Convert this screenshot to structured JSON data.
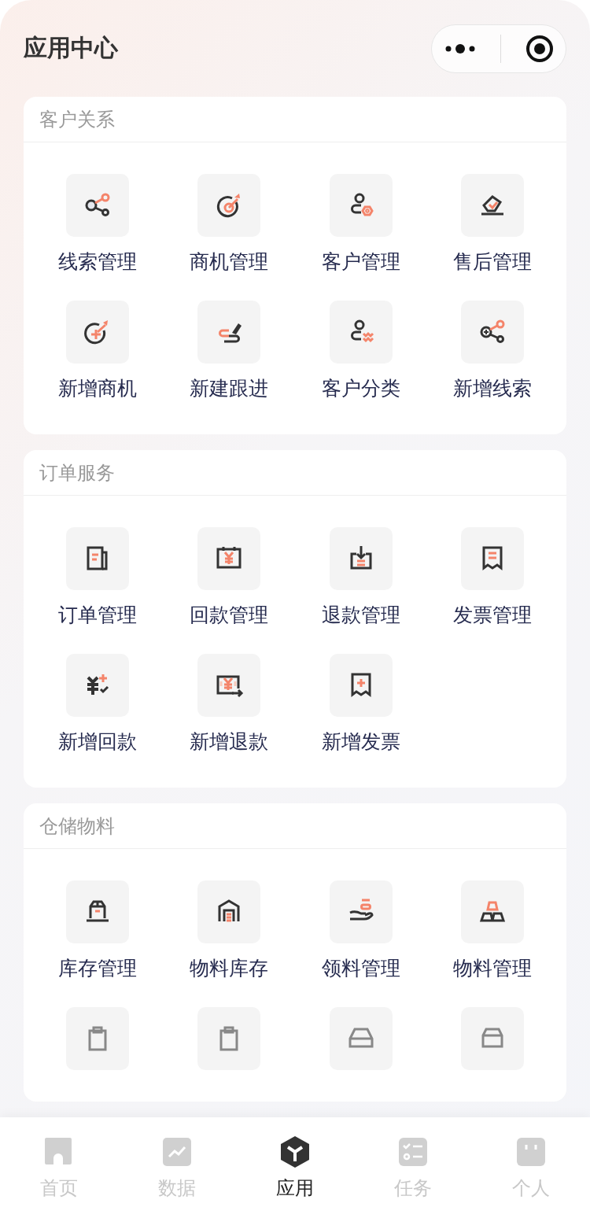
{
  "header": {
    "title": "应用中心"
  },
  "sections": [
    {
      "title": "客户关系",
      "items": [
        {
          "kind": "app",
          "label": "线索管理"
        },
        {
          "kind": "app",
          "label": "商机管理"
        },
        {
          "kind": "app",
          "label": "客户管理"
        },
        {
          "kind": "app",
          "label": "售后管理"
        },
        {
          "kind": "app",
          "label": "新增商机"
        },
        {
          "kind": "app",
          "label": "新建跟进"
        },
        {
          "kind": "app",
          "label": "客户分类"
        },
        {
          "kind": "app",
          "label": "新增线索"
        }
      ]
    },
    {
      "title": "订单服务",
      "items": [
        {
          "kind": "app",
          "label": "订单管理"
        },
        {
          "kind": "app",
          "label": "回款管理"
        },
        {
          "kind": "app",
          "label": "退款管理"
        },
        {
          "kind": "app",
          "label": "发票管理"
        },
        {
          "kind": "app",
          "label": "新增回款"
        },
        {
          "kind": "app",
          "label": "新增退款"
        },
        {
          "kind": "app",
          "label": "新增发票"
        }
      ]
    },
    {
      "title": "仓储物料",
      "items": [
        {
          "kind": "app",
          "label": "库存管理"
        },
        {
          "kind": "app",
          "label": "物料库存"
        },
        {
          "kind": "app",
          "label": "领料管理"
        },
        {
          "kind": "app",
          "label": "物料管理"
        },
        {
          "kind": "partial"
        },
        {
          "kind": "partial"
        },
        {
          "kind": "partial"
        },
        {
          "kind": "partial"
        }
      ]
    }
  ],
  "tab_bar": [
    {
      "label": "首页",
      "selected": false
    },
    {
      "label": "数据",
      "selected": false
    },
    {
      "label": "应用",
      "selected": true
    },
    {
      "label": "任务",
      "selected": false
    },
    {
      "label": "个人",
      "selected": false
    }
  ]
}
